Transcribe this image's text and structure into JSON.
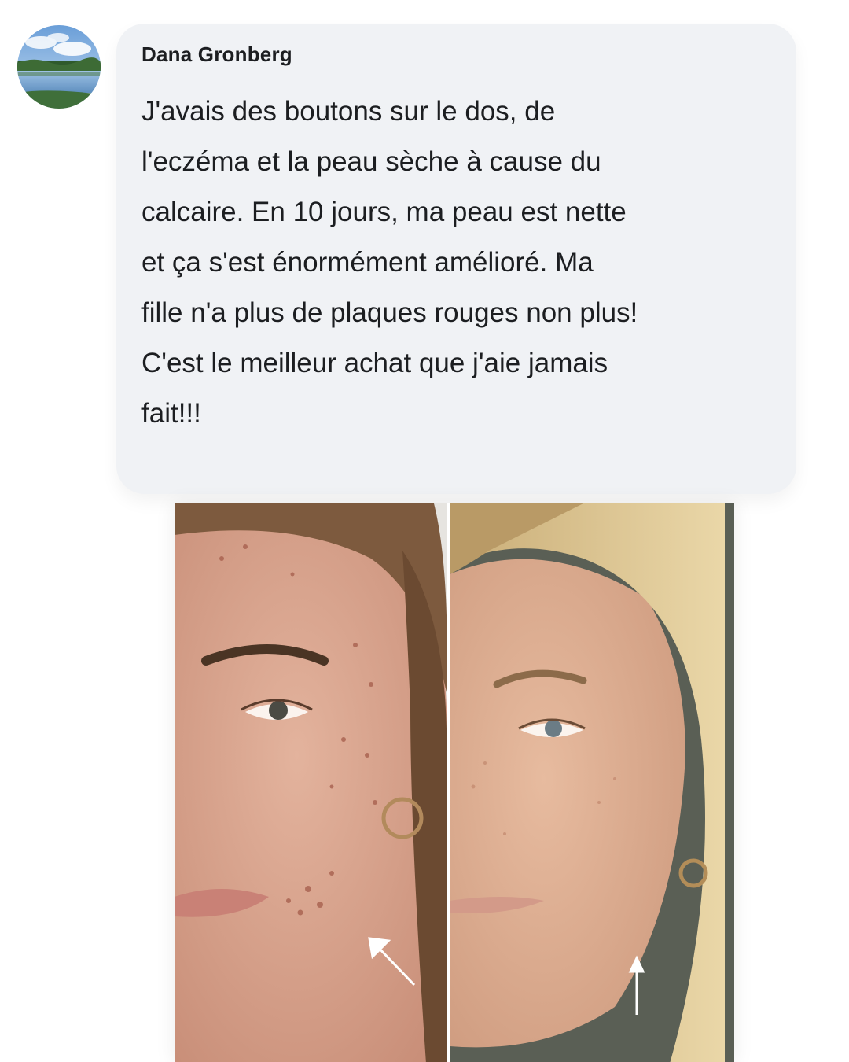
{
  "comment": {
    "author": "Dana Gronberg",
    "text": "J'avais des boutons sur le dos, de\nl'eczéma et la peau sèche à cause du\ncalcaire. En 10 jours, ma peau est nette\net ça s'est énormément amélioré. Ma\nfille n'a plus de plaques rouges non plus!\nC'est le meilleur achat que j'aie jamais\nfait!!!"
  },
  "colors": {
    "bubble": "#f0f2f5",
    "text": "#1c1e21",
    "skin_before": "#d9a48f",
    "skin_after": "#dfae93",
    "hair_before": "#7d5a3e",
    "hair_after": "#d8c08d"
  },
  "icons": {
    "avatar": "lake-landscape-avatar",
    "photo": "before-after-face-photo",
    "arrow_before": "arrow-up-left-icon",
    "arrow_after": "arrow-up-icon"
  }
}
